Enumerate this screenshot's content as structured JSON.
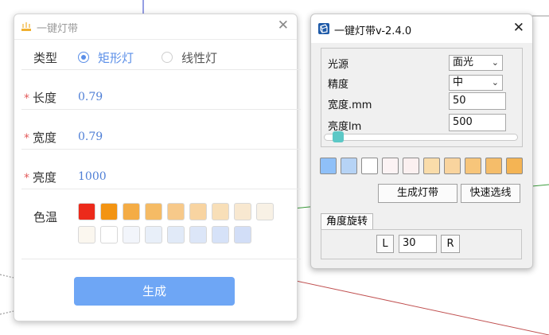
{
  "left_dialog": {
    "title": "一键灯带",
    "close": "✕",
    "type_label": "类型",
    "type_options": [
      {
        "label": "矩形灯",
        "selected": true
      },
      {
        "label": "线性灯",
        "selected": false
      }
    ],
    "length_label": "长度",
    "length_value": "0.79",
    "width_label": "宽度",
    "width_value": "0.79",
    "brightness_label": "亮度",
    "brightness_value": "1000",
    "required_mark": "*",
    "color_temp_label": "色温",
    "swatches_row1": [
      "#ec2a1b",
      "#f39412",
      "#f4ac45",
      "#f5bb65",
      "#f7c98a",
      "#f8d4a1",
      "#f8dfb8",
      "#f8e8d0",
      "#f8f1e5"
    ],
    "swatches_row2": [
      "#fbf7ef",
      "#ffffff",
      "#f2f5fb",
      "#e8eff9",
      "#e1eaf8",
      "#dce6f8",
      "#d6e2f8",
      "#d2def7"
    ],
    "generate_label": "生成",
    "accent": "#5b8fe8"
  },
  "right_dialog": {
    "title": "一键灯带v-2.4.0",
    "close": "✕",
    "light_source_label": "光源",
    "light_source_value": "面光",
    "precision_label": "精度",
    "precision_value": "中",
    "width_label": "宽度.mm",
    "width_value": "50",
    "brightness_label": "亮度lm",
    "brightness_value": "500",
    "swatches": [
      "#8fc0f8",
      "#b6d3f5",
      "#ffffff",
      "#fcf3f4",
      "#fbf0f0",
      "#f9dcaa",
      "#f9d49e",
      "#f7c57a",
      "#f5bd6a",
      "#f4b454"
    ],
    "generate_button": "生成灯带",
    "quick_select_button": "快速选线",
    "rotation_tab": "角度旋转",
    "rotate_left": "L",
    "rotation_value": "30",
    "rotate_right": "R"
  }
}
